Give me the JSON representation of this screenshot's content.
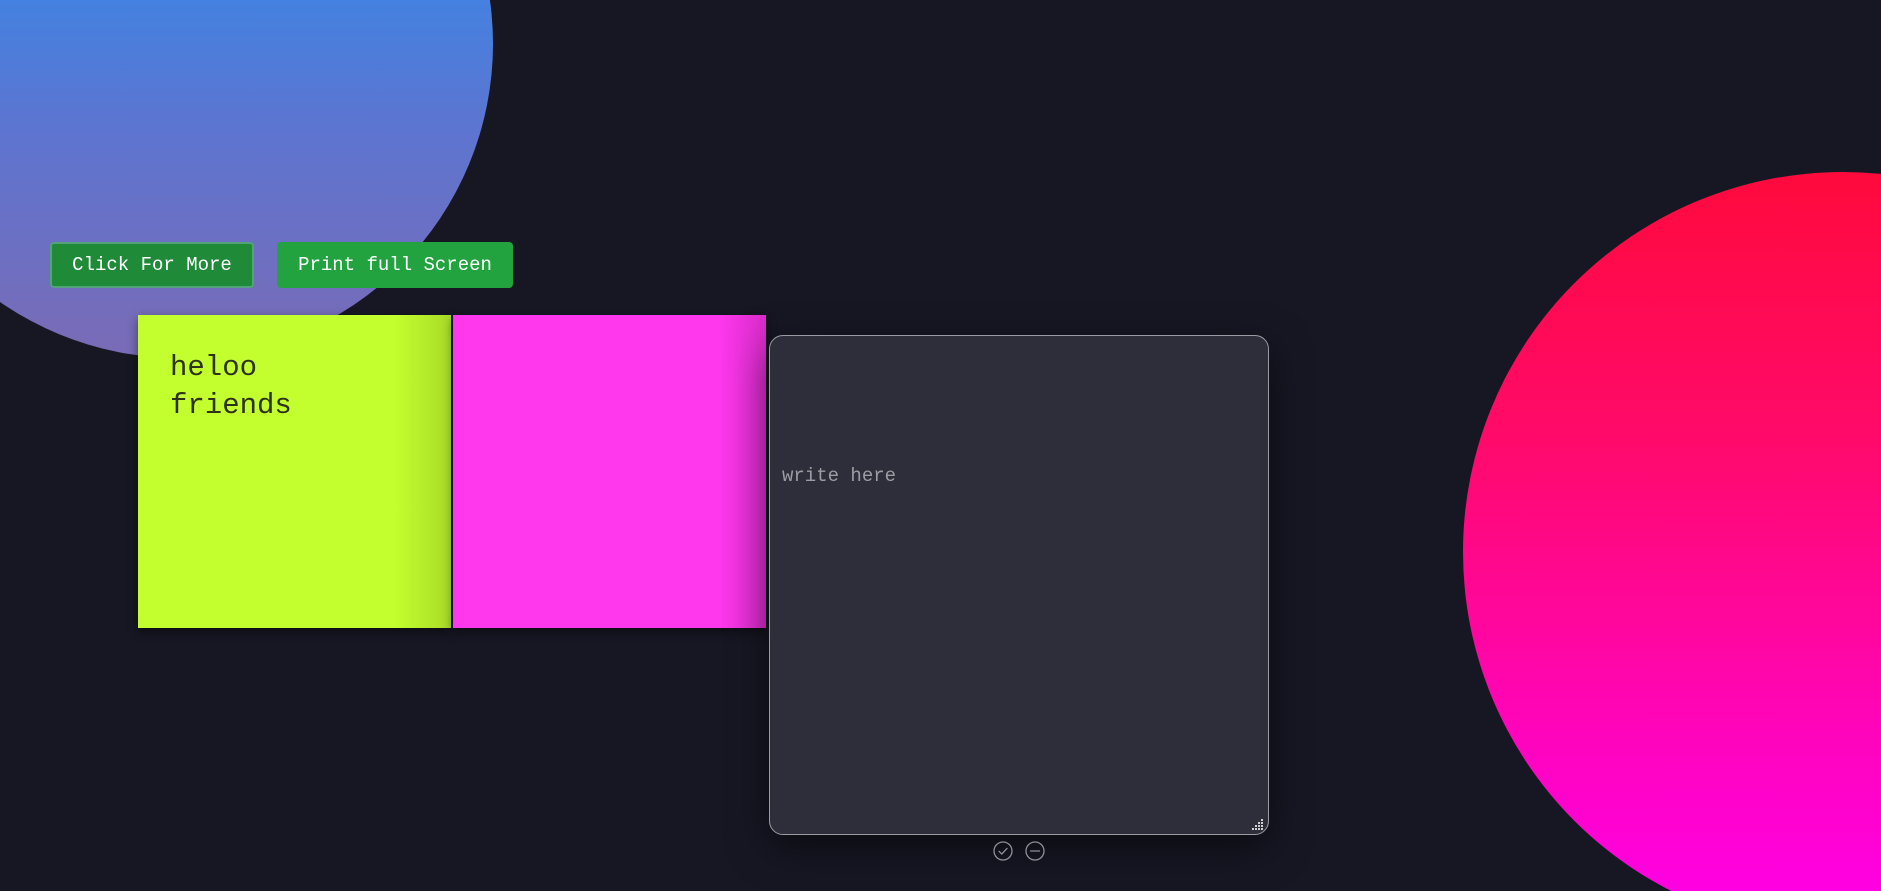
{
  "buttons": {
    "more_label": "Click For More",
    "print_label": "Print full Screen"
  },
  "notes": [
    {
      "color": "#c3ff2e",
      "lines": [
        "heloo",
        "friends"
      ]
    },
    {
      "color": "#ff38ee",
      "lines": []
    }
  ],
  "editor": {
    "placeholder": "write here",
    "value": ""
  },
  "actions": {
    "confirm_icon": "check-circle-icon",
    "remove_icon": "minus-circle-icon"
  },
  "background": {
    "base": "#161723",
    "blob_top_left": [
      "#1f95f2",
      "#7a6bb6"
    ],
    "blob_right": [
      "#ff0a3c",
      "#ff00ec"
    ]
  }
}
